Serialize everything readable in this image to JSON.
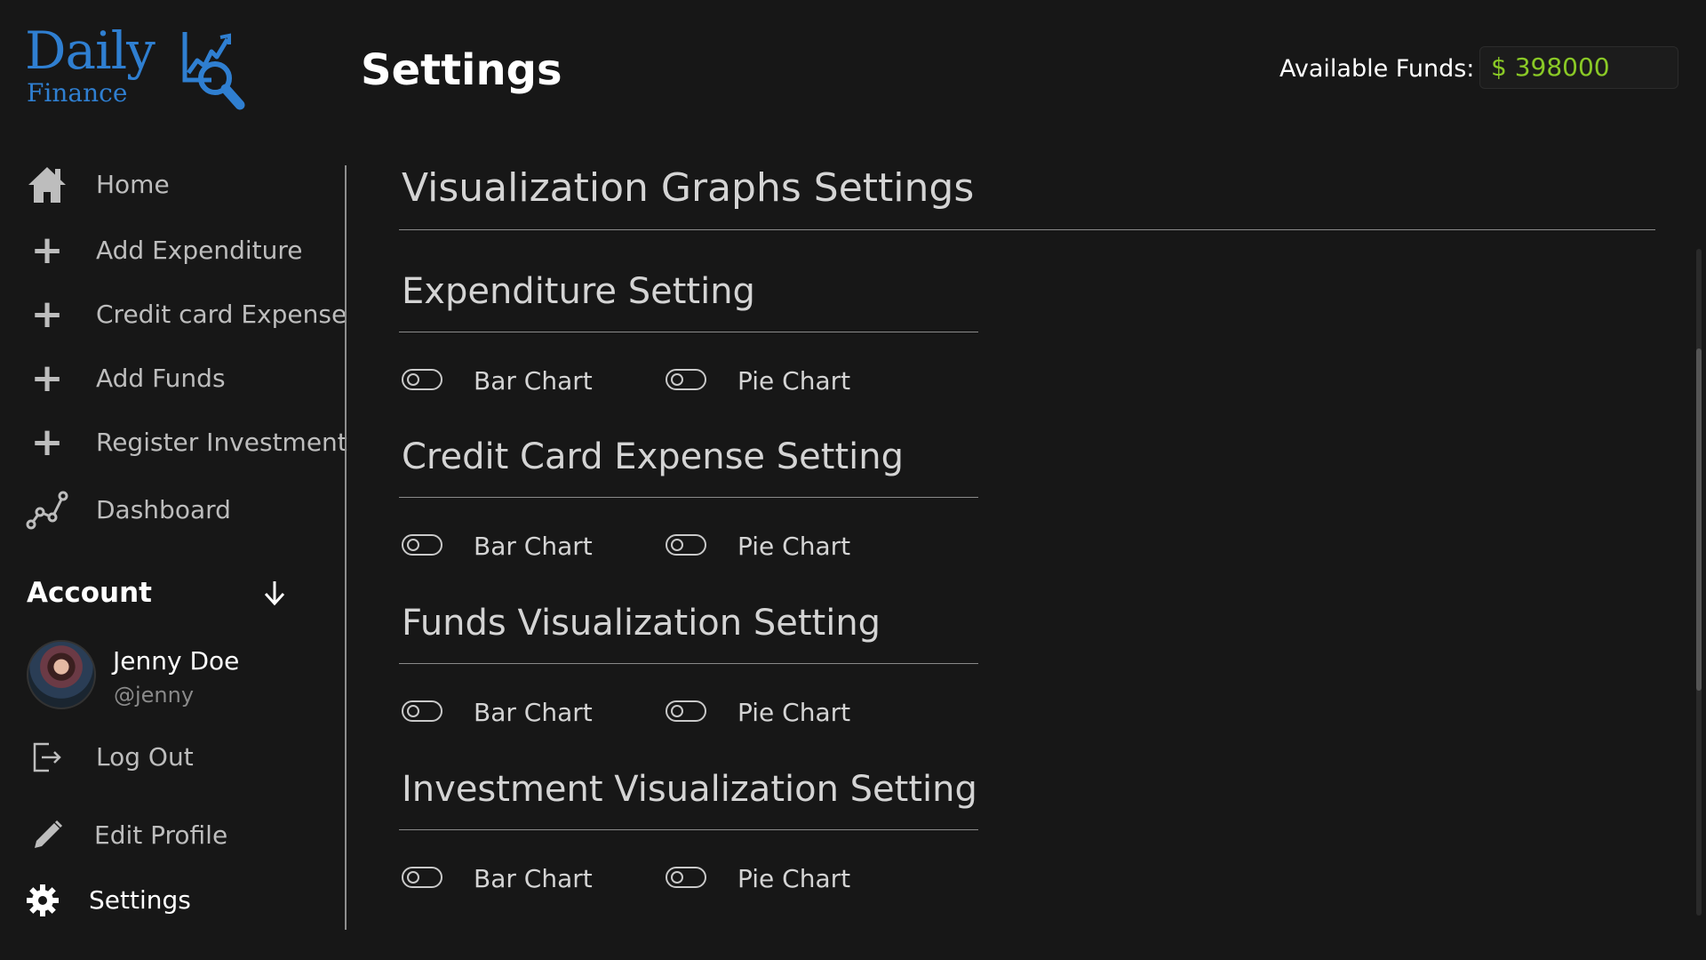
{
  "app": {
    "logo_word": "Daily",
    "logo_sub": "Finance",
    "page_title": "Settings",
    "funds_label": "Available Funds:",
    "funds_value": "$ 398000",
    "accent_color": "#2f7fd1",
    "funds_color": "#8ac926"
  },
  "sidebar": {
    "items": [
      {
        "label": "Home",
        "icon": "home-icon"
      },
      {
        "label": "Add Expenditure",
        "icon": "plus-icon"
      },
      {
        "label": "Credit card Expense",
        "icon": "plus-icon"
      },
      {
        "label": "Add Funds",
        "icon": "plus-icon"
      },
      {
        "label": "Register Investment",
        "icon": "plus-icon"
      },
      {
        "label": "Dashboard",
        "icon": "chart-line-icon"
      }
    ],
    "account": {
      "heading": "Account",
      "name": "Jenny Doe",
      "handle": "@jenny",
      "logout": "Log Out",
      "edit_profile": "Edit Profile",
      "settings": "Settings"
    }
  },
  "main": {
    "title": "Visualization Graphs Settings",
    "sections": [
      {
        "title": "Expenditure Setting",
        "options": [
          {
            "label": "Bar Chart",
            "on": false
          },
          {
            "label": "Pie Chart",
            "on": false
          }
        ]
      },
      {
        "title": "Credit Card Expense Setting",
        "options": [
          {
            "label": "Bar Chart",
            "on": false
          },
          {
            "label": "Pie Chart",
            "on": false
          }
        ]
      },
      {
        "title": "Funds Visualization Setting",
        "options": [
          {
            "label": "Bar Chart",
            "on": false
          },
          {
            "label": "Pie Chart",
            "on": false
          }
        ]
      },
      {
        "title": "Investment Visualization Setting",
        "options": [
          {
            "label": "Bar Chart",
            "on": false
          },
          {
            "label": "Pie Chart",
            "on": false
          }
        ]
      }
    ]
  }
}
